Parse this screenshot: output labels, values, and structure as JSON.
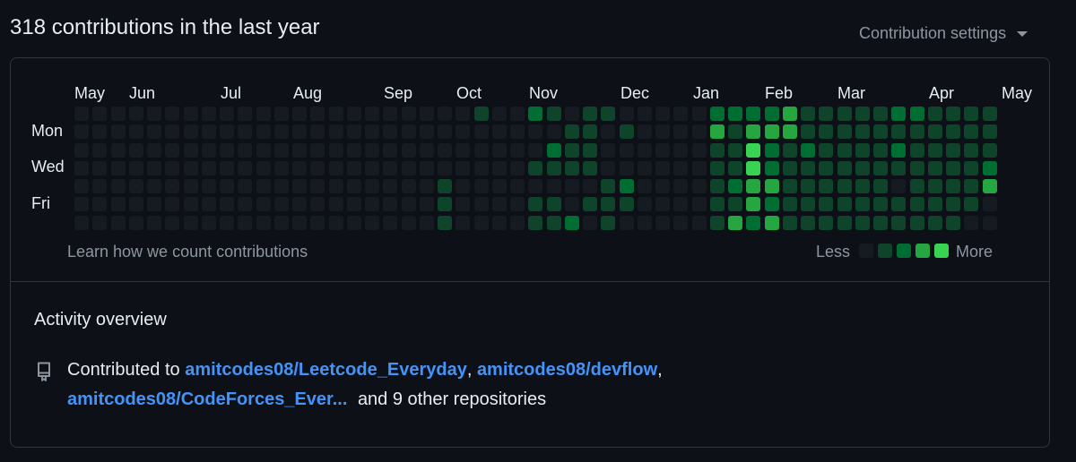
{
  "header": {
    "title": "318 contributions in the last year",
    "settings_label": "Contribution settings"
  },
  "calendar": {
    "months": [
      "May",
      "Jun",
      "Jul",
      "Aug",
      "Sep",
      "Oct",
      "Nov",
      "Dec",
      "Jan",
      "Feb",
      "Mar",
      "Apr",
      "May"
    ],
    "day_labels": [
      "Mon",
      "Wed",
      "Fri"
    ],
    "level_colors": [
      "#161b22",
      "#0e4429",
      "#006d32",
      "#26a641",
      "#39d353"
    ],
    "weeks": [
      [
        0,
        0,
        0,
        0,
        0,
        0,
        0
      ],
      [
        0,
        0,
        0,
        0,
        0,
        0,
        0
      ],
      [
        0,
        0,
        0,
        0,
        0,
        0,
        0
      ],
      [
        0,
        0,
        0,
        0,
        0,
        0,
        0
      ],
      [
        0,
        0,
        0,
        0,
        0,
        0,
        0
      ],
      [
        0,
        0,
        0,
        0,
        0,
        0,
        0
      ],
      [
        0,
        0,
        0,
        0,
        0,
        0,
        0
      ],
      [
        0,
        0,
        0,
        0,
        0,
        0,
        0
      ],
      [
        0,
        0,
        0,
        0,
        0,
        0,
        0
      ],
      [
        0,
        0,
        0,
        0,
        0,
        0,
        0
      ],
      [
        0,
        0,
        0,
        0,
        0,
        0,
        0
      ],
      [
        0,
        0,
        0,
        0,
        0,
        0,
        0
      ],
      [
        0,
        0,
        0,
        0,
        0,
        0,
        0
      ],
      [
        0,
        0,
        0,
        0,
        0,
        0,
        0
      ],
      [
        0,
        0,
        0,
        0,
        0,
        0,
        0
      ],
      [
        0,
        0,
        0,
        0,
        0,
        0,
        0
      ],
      [
        0,
        0,
        0,
        0,
        0,
        0,
        0
      ],
      [
        0,
        0,
        0,
        0,
        0,
        0,
        0
      ],
      [
        0,
        0,
        0,
        0,
        0,
        0,
        0
      ],
      [
        0,
        0,
        0,
        0,
        0,
        0,
        0
      ],
      [
        0,
        0,
        0,
        0,
        1,
        1,
        1
      ],
      [
        0,
        0,
        0,
        0,
        0,
        0,
        0
      ],
      [
        1,
        0,
        0,
        0,
        0,
        0,
        0
      ],
      [
        0,
        0,
        0,
        0,
        0,
        0,
        0
      ],
      [
        0,
        0,
        0,
        0,
        0,
        0,
        0
      ],
      [
        2,
        0,
        0,
        1,
        0,
        1,
        1
      ],
      [
        1,
        0,
        2,
        1,
        0,
        1,
        1
      ],
      [
        0,
        1,
        1,
        1,
        0,
        0,
        2
      ],
      [
        1,
        1,
        1,
        1,
        0,
        1,
        0
      ],
      [
        1,
        0,
        0,
        0,
        1,
        1,
        1
      ],
      [
        0,
        1,
        0,
        0,
        2,
        1,
        0
      ],
      [
        0,
        0,
        0,
        0,
        0,
        0,
        0
      ],
      [
        0,
        0,
        0,
        0,
        0,
        0,
        0
      ],
      [
        0,
        0,
        0,
        0,
        0,
        0,
        0
      ],
      [
        0,
        0,
        0,
        0,
        0,
        0,
        0
      ],
      [
        2,
        3,
        1,
        1,
        1,
        1,
        1
      ],
      [
        2,
        1,
        1,
        1,
        2,
        1,
        3
      ],
      [
        2,
        3,
        4,
        4,
        3,
        3,
        2
      ],
      [
        2,
        3,
        2,
        2,
        3,
        2,
        3
      ],
      [
        3,
        3,
        1,
        1,
        1,
        1,
        1
      ],
      [
        1,
        1,
        2,
        1,
        1,
        1,
        1
      ],
      [
        1,
        1,
        1,
        1,
        1,
        1,
        1
      ],
      [
        1,
        1,
        1,
        1,
        1,
        1,
        1
      ],
      [
        1,
        1,
        1,
        1,
        1,
        1,
        1
      ],
      [
        1,
        1,
        1,
        1,
        1,
        1,
        1
      ],
      [
        2,
        1,
        2,
        1,
        0,
        1,
        1
      ],
      [
        2,
        1,
        1,
        1,
        1,
        1,
        1
      ],
      [
        1,
        1,
        1,
        1,
        1,
        1,
        1
      ],
      [
        1,
        1,
        1,
        1,
        1,
        1,
        1
      ],
      [
        1,
        1,
        1,
        1,
        1,
        1,
        0
      ],
      [
        1,
        1,
        1,
        2,
        3,
        0,
        0
      ]
    ]
  },
  "footer": {
    "learn_link": "Learn how we count contributions",
    "legend_less": "Less",
    "legend_more": "More"
  },
  "activity": {
    "title": "Activity overview",
    "prefix": "Contributed to",
    "repo1": "amitcodes08/Leetcode_Everyday",
    "sep1": ",",
    "repo2": "amitcodes08/devflow",
    "sep2": ",",
    "repo3": "amitcodes08/CodeForces_Ever...",
    "suffix": "and 9 other repositories"
  }
}
